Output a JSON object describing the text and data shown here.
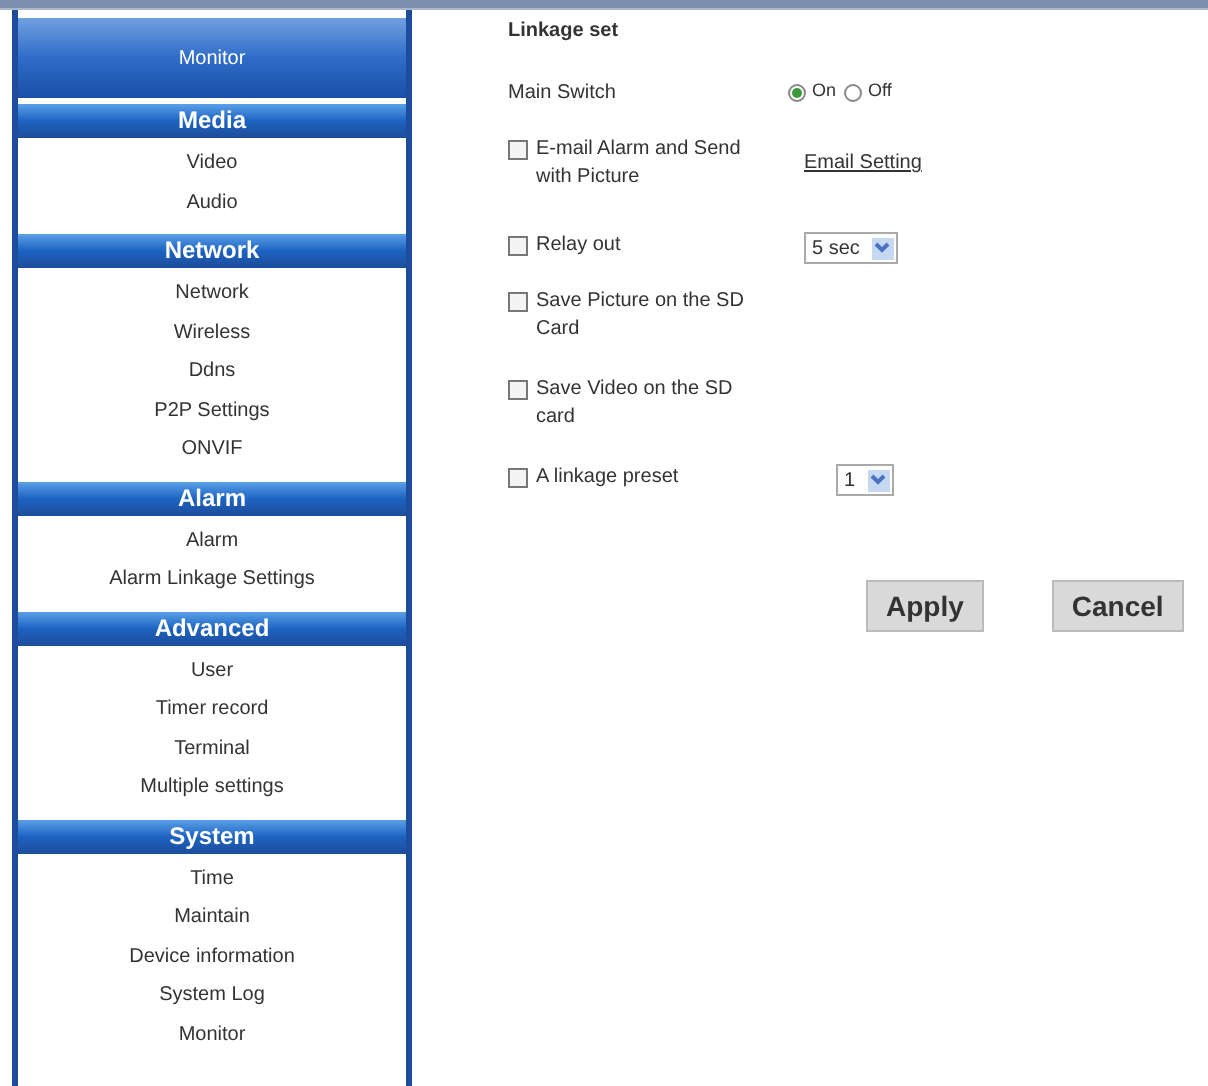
{
  "sidebar": {
    "header": "Monitor",
    "sections": [
      {
        "title": "Media",
        "items": [
          "Video",
          "Audio"
        ]
      },
      {
        "title": "Network",
        "items": [
          "Network",
          "Wireless",
          "Ddns",
          "P2P Settings",
          "ONVIF"
        ]
      },
      {
        "title": "Alarm",
        "items": [
          "Alarm",
          "Alarm Linkage Settings"
        ]
      },
      {
        "title": "Advanced",
        "items": [
          "User",
          "Timer record",
          "Terminal",
          "Multiple settings"
        ]
      },
      {
        "title": "System",
        "items": [
          "Time",
          "Maintain",
          "Device information",
          "System Log",
          "Monitor"
        ]
      }
    ]
  },
  "form": {
    "title": "Linkage set",
    "main_switch": {
      "label": "Main Switch",
      "options": [
        {
          "label": "On",
          "selected": true
        },
        {
          "label": "Off",
          "selected": false
        }
      ]
    },
    "rows": [
      {
        "kind": "link",
        "label": "E-mail Alarm and Send with Picture",
        "checked": false,
        "link": "Email Setting"
      },
      {
        "kind": "select",
        "label": "Relay out",
        "checked": false,
        "value": "5 sec"
      },
      {
        "kind": "plain",
        "label": "Save Picture on the SD Card",
        "checked": false
      },
      {
        "kind": "plain",
        "label": "Save Video on the SD card",
        "checked": false
      },
      {
        "kind": "select",
        "label": "A linkage preset",
        "checked": false,
        "value": "1"
      }
    ],
    "buttons": [
      "Apply",
      "Cancel"
    ]
  }
}
